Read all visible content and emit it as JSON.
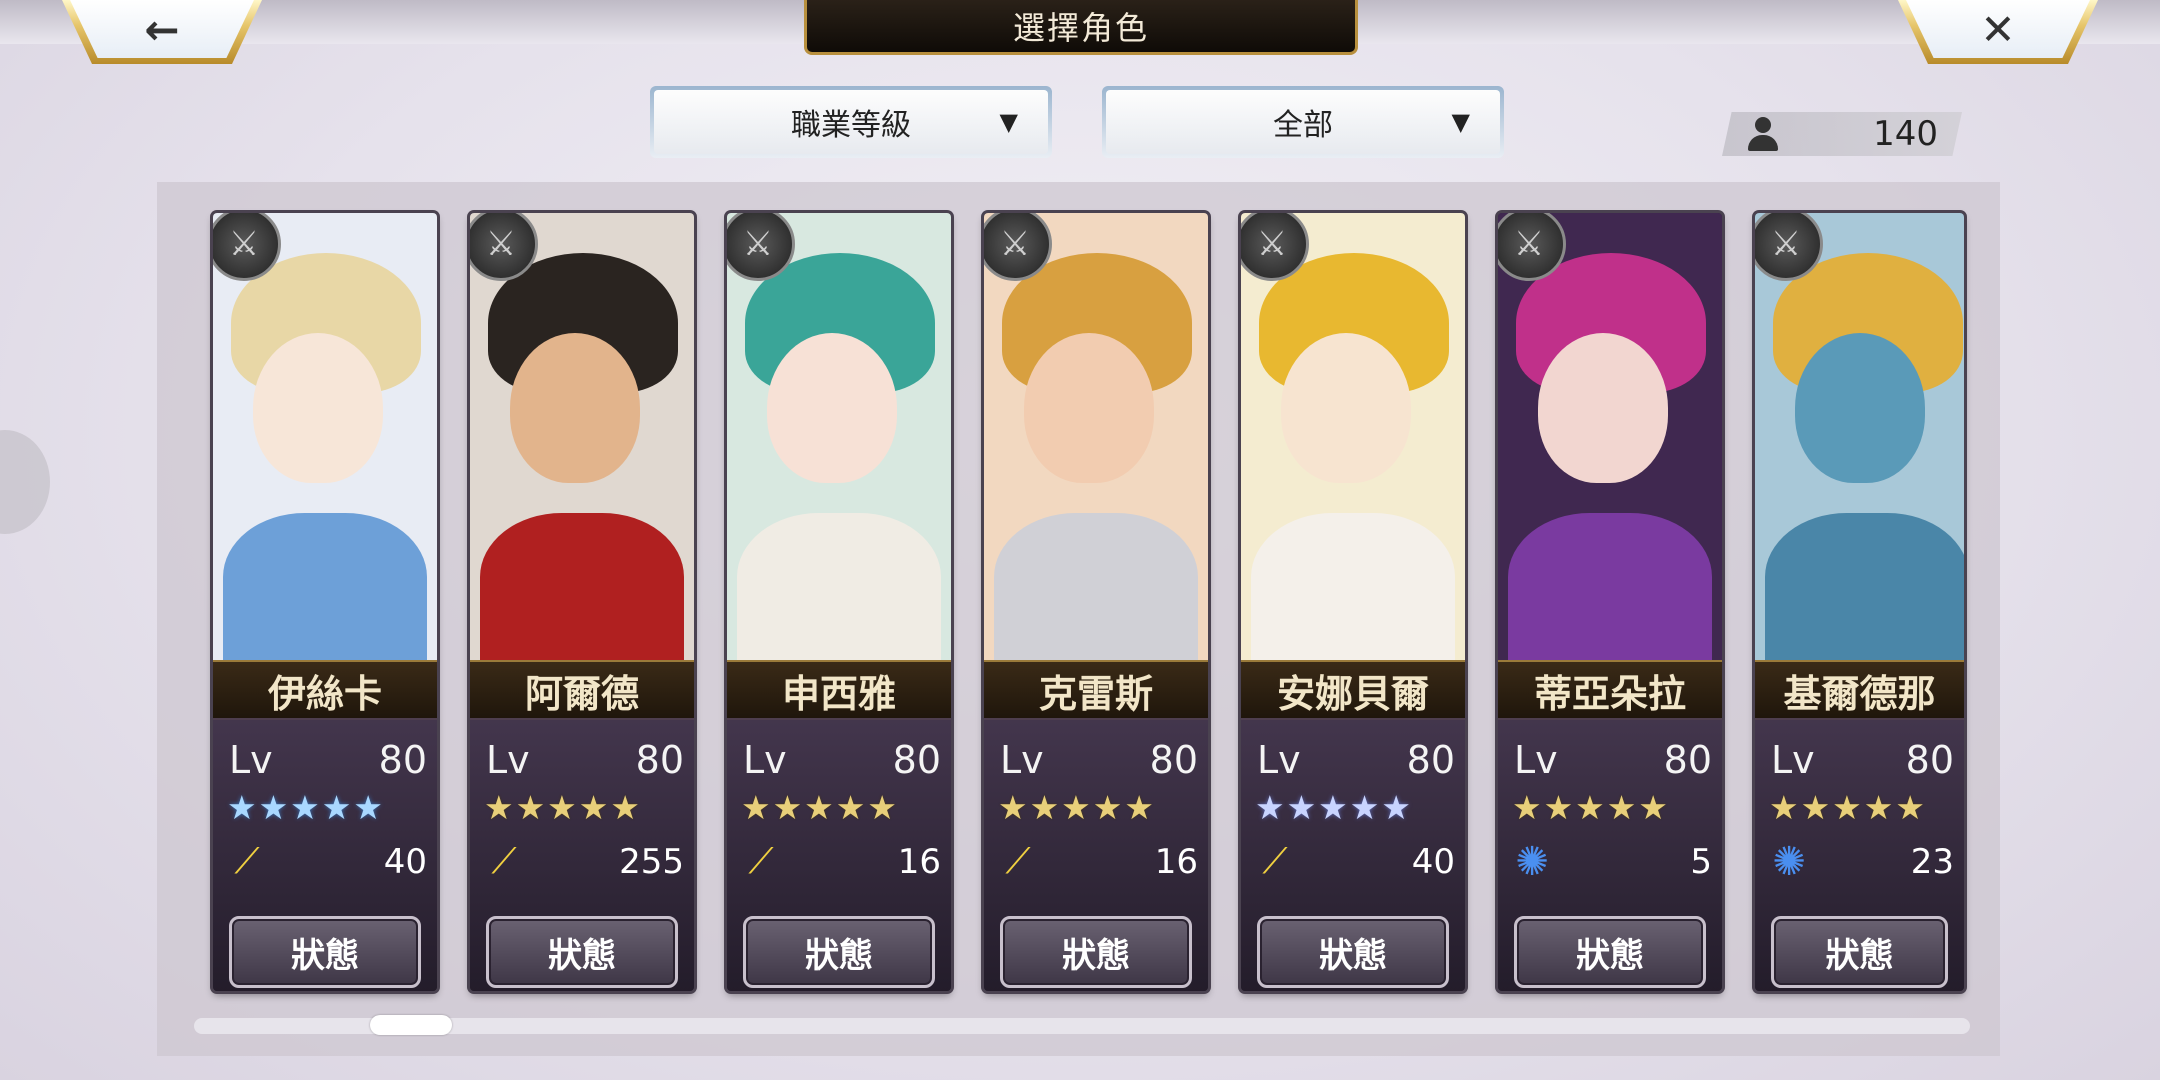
{
  "header": {
    "title": "選擇角色",
    "back_icon": "←",
    "close_icon": "✕"
  },
  "filters": {
    "sort_label": "職業等級",
    "filter_label": "全部",
    "arrow": "▼"
  },
  "unit_count": "140",
  "characters": [
    {
      "name": "伊絲卡",
      "lv_label": "Lv",
      "level": "80",
      "stars": "★★★★★",
      "star_color": "blue",
      "resource_icon": "wing",
      "resource_glyph": "⟋",
      "resource": "40",
      "status_label": "狀態",
      "colors": {
        "bg": "#e8ecf4",
        "hair": "#e8d7a6",
        "face": "#f7e6d8",
        "body": "#6da0d8"
      }
    },
    {
      "name": "阿爾德",
      "lv_label": "Lv",
      "level": "80",
      "stars": "★★★★★",
      "star_color": "gold",
      "resource_icon": "wing",
      "resource_glyph": "⟋",
      "resource": "255",
      "status_label": "狀態",
      "colors": {
        "bg": "#e0d8d0",
        "hair": "#2a2420",
        "face": "#e2b48c",
        "body": "#b02020"
      }
    },
    {
      "name": "申西雅",
      "lv_label": "Lv",
      "level": "80",
      "stars": "★★★★★",
      "star_color": "gold",
      "resource_icon": "wing",
      "resource_glyph": "⟋",
      "resource": "16",
      "status_label": "狀態",
      "colors": {
        "bg": "#d8e8e0",
        "hair": "#3aa598",
        "face": "#f7e1d6",
        "body": "#f0ece4"
      }
    },
    {
      "name": "克雷斯",
      "lv_label": "Lv",
      "level": "80",
      "stars": "★★★★★",
      "star_color": "gold",
      "resource_icon": "wing",
      "resource_glyph": "⟋",
      "resource": "16",
      "status_label": "狀態",
      "colors": {
        "bg": "#f2d8c0",
        "hair": "#d8a040",
        "face": "#f2ccb0",
        "body": "#d0d0d6"
      }
    },
    {
      "name": "安娜貝爾",
      "lv_label": "Lv",
      "level": "80",
      "stars": "★★★★★",
      "star_color": "silver",
      "resource_icon": "wing",
      "resource_glyph": "⟋",
      "resource": "40",
      "status_label": "狀態",
      "colors": {
        "bg": "#f4ecd0",
        "hair": "#e8b830",
        "face": "#f7e4d0",
        "body": "#f4f0ea"
      }
    },
    {
      "name": "蒂亞朵拉",
      "lv_label": "Lv",
      "level": "80",
      "stars": "★★★★★",
      "star_color": "gold",
      "resource_icon": "swirl",
      "resource_glyph": "✺",
      "resource": "5",
      "status_label": "狀態",
      "colors": {
        "bg": "#402850",
        "hair": "#c0308a",
        "face": "#f2d6d0",
        "body": "#7a3aa0"
      }
    },
    {
      "name": "基爾德那",
      "lv_label": "Lv",
      "level": "80",
      "stars": "★★★★★",
      "star_color": "gold",
      "resource_icon": "swirl",
      "resource_glyph": "✺",
      "resource": "23",
      "status_label": "狀態",
      "colors": {
        "bg": "#a8c8d8",
        "hair": "#e0b040",
        "face": "#5a9ab8",
        "body": "#4a86a8"
      }
    }
  ]
}
